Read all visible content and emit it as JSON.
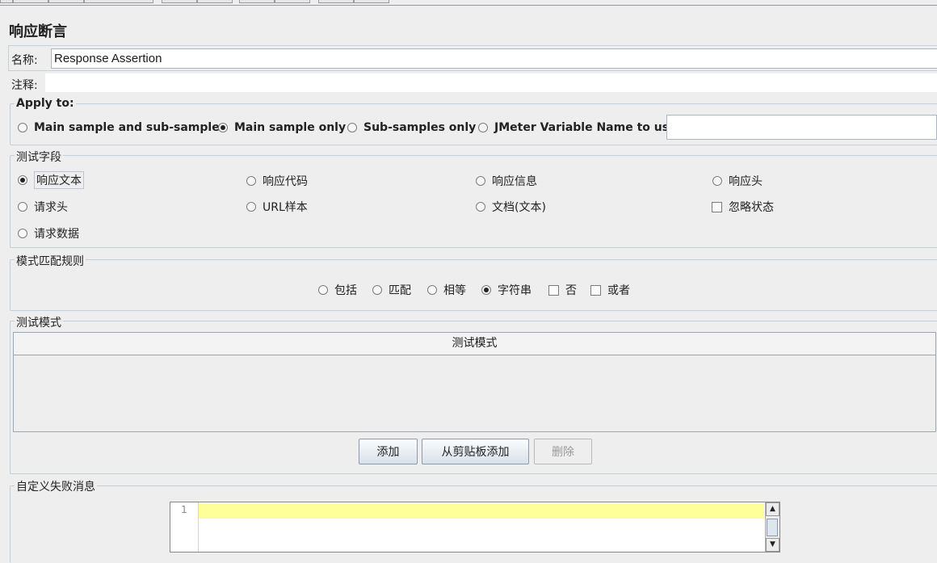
{
  "title": "响应断言",
  "name_field": {
    "label": "名称:",
    "value": "Response Assertion"
  },
  "comment_field": {
    "label": "注释:",
    "value": ""
  },
  "apply_to": {
    "title": "Apply to:",
    "options": [
      "Main sample and sub-samples",
      "Main sample only",
      "Sub-samples only",
      "JMeter Variable Name to use"
    ],
    "selected": "Main sample only",
    "variable_value": ""
  },
  "test_field": {
    "title": "测试字段",
    "radios": [
      "响应文本",
      "响应代码",
      "响应信息",
      "响应头",
      "请求头",
      "URL样本",
      "文档(文本)",
      "请求数据"
    ],
    "selected": "响应文本",
    "checkbox": {
      "label": "忽略状态",
      "checked": false
    }
  },
  "match_rules": {
    "title": "模式匹配规则",
    "radios": [
      "包括",
      "匹配",
      "相等",
      "字符串"
    ],
    "selected": "字符串",
    "checkboxes": [
      {
        "label": "否",
        "checked": false
      },
      {
        "label": "或者",
        "checked": false
      }
    ]
  },
  "patterns": {
    "title": "测试模式",
    "column_header": "测试模式",
    "buttons": {
      "add": "添加",
      "add_clipboard": "从剪贴板添加",
      "delete": "删除"
    }
  },
  "custom_message": {
    "title": "自定义失败消息",
    "line_number": "1",
    "value": "",
    "scroll_up": "▲",
    "scroll_down": "▼"
  }
}
